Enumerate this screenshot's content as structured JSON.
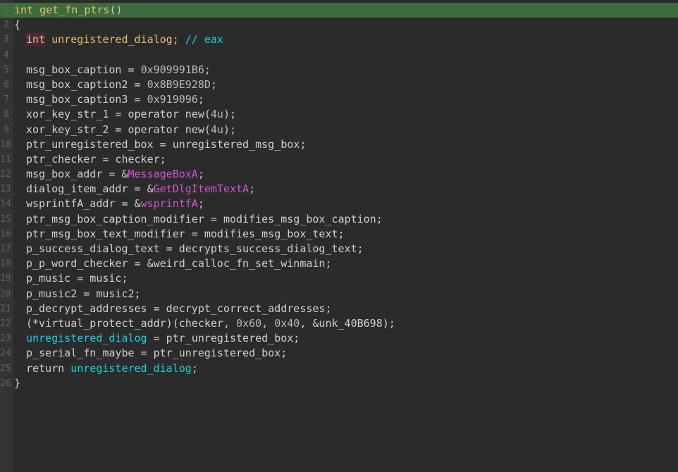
{
  "colors": {
    "background": "#2b2b2b",
    "highlight_line": "#3d6b3d",
    "keyword": "#e8bf6a",
    "import": "#d455d4",
    "global": "#1cd1e0",
    "plain": "#d0d0d0"
  },
  "code": {
    "lines": [
      {
        "num": "1",
        "indent": 0,
        "highlight": true,
        "tokens": [
          {
            "t": "int",
            "c": "keyword"
          },
          {
            "t": " ",
            "c": "plain"
          },
          {
            "t": "get_fn_ptrs",
            "c": "function"
          },
          {
            "t": "()",
            "c": "punct"
          }
        ]
      },
      {
        "num": "2",
        "indent": 0,
        "tokens": [
          {
            "t": "{",
            "c": "punct"
          }
        ]
      },
      {
        "num": "3",
        "indent": 1,
        "tokens": [
          {
            "t": "int",
            "c": "type"
          },
          {
            "t": " ",
            "c": "plain"
          },
          {
            "t": "unregistered_dialog",
            "c": "keyword"
          },
          {
            "t": "; ",
            "c": "punct"
          },
          {
            "t": "// eax",
            "c": "comment"
          }
        ]
      },
      {
        "num": "4",
        "indent": 0,
        "tokens": []
      },
      {
        "num": "5",
        "indent": 1,
        "tokens": [
          {
            "t": "msg_box_caption = ",
            "c": "plain"
          },
          {
            "t": "0x909991B6",
            "c": "number"
          },
          {
            "t": ";",
            "c": "punct"
          }
        ]
      },
      {
        "num": "6",
        "indent": 1,
        "tokens": [
          {
            "t": "msg_box_caption2 = ",
            "c": "plain"
          },
          {
            "t": "0x8B9E928D",
            "c": "number"
          },
          {
            "t": ";",
            "c": "punct"
          }
        ]
      },
      {
        "num": "7",
        "indent": 1,
        "tokens": [
          {
            "t": "msg_box_caption3 = ",
            "c": "plain"
          },
          {
            "t": "0x919096",
            "c": "number"
          },
          {
            "t": ";",
            "c": "punct"
          }
        ]
      },
      {
        "num": "8",
        "indent": 1,
        "tokens": [
          {
            "t": "xor_key_str_1 = operator new(",
            "c": "plain"
          },
          {
            "t": "4u",
            "c": "number"
          },
          {
            "t": ");",
            "c": "punct"
          }
        ]
      },
      {
        "num": "9",
        "indent": 1,
        "tokens": [
          {
            "t": "xor_key_str_2 = operator new(",
            "c": "plain"
          },
          {
            "t": "4u",
            "c": "number"
          },
          {
            "t": ");",
            "c": "punct"
          }
        ]
      },
      {
        "num": "10",
        "indent": 1,
        "tokens": [
          {
            "t": "ptr_unregistered_box = unregistered_msg_box;",
            "c": "plain"
          }
        ]
      },
      {
        "num": "11",
        "indent": 1,
        "tokens": [
          {
            "t": "ptr_checker = checker;",
            "c": "plain"
          }
        ]
      },
      {
        "num": "12",
        "indent": 1,
        "tokens": [
          {
            "t": "msg_box_addr = &",
            "c": "plain"
          },
          {
            "t": "MessageBoxA",
            "c": "import"
          },
          {
            "t": ";",
            "c": "punct"
          }
        ]
      },
      {
        "num": "13",
        "indent": 1,
        "tokens": [
          {
            "t": "dialog_item_addr = &",
            "c": "plain"
          },
          {
            "t": "GetDlgItemTextA",
            "c": "import"
          },
          {
            "t": ";",
            "c": "punct"
          }
        ]
      },
      {
        "num": "14",
        "indent": 1,
        "tokens": [
          {
            "t": "wsprintfA_addr = &",
            "c": "plain"
          },
          {
            "t": "wsprintfA",
            "c": "import"
          },
          {
            "t": ";",
            "c": "punct"
          }
        ]
      },
      {
        "num": "15",
        "indent": 1,
        "tokens": [
          {
            "t": "ptr_msg_box_caption_modifier = modifies_msg_box_caption;",
            "c": "plain"
          }
        ]
      },
      {
        "num": "16",
        "indent": 1,
        "tokens": [
          {
            "t": "ptr_msg_box_text_modifier = modifies_msg_box_text;",
            "c": "plain"
          }
        ]
      },
      {
        "num": "17",
        "indent": 1,
        "tokens": [
          {
            "t": "p_success_dialog_text = decrypts_success_dialog_text;",
            "c": "plain"
          }
        ]
      },
      {
        "num": "18",
        "indent": 1,
        "tokens": [
          {
            "t": "p_p_word_checker = &weird_calloc_fn_set_winmain;",
            "c": "plain"
          }
        ]
      },
      {
        "num": "19",
        "indent": 1,
        "tokens": [
          {
            "t": "p_music = music;",
            "c": "plain"
          }
        ]
      },
      {
        "num": "20",
        "indent": 1,
        "tokens": [
          {
            "t": "p_music2 = music2;",
            "c": "plain"
          }
        ]
      },
      {
        "num": "21",
        "indent": 1,
        "tokens": [
          {
            "t": "p_decrypt_addresses = decrypt_correct_addresses;",
            "c": "plain"
          }
        ]
      },
      {
        "num": "22",
        "indent": 1,
        "tokens": [
          {
            "t": "(*virtual_protect_addr)(checker, ",
            "c": "plain"
          },
          {
            "t": "0x60",
            "c": "number"
          },
          {
            "t": ", ",
            "c": "plain"
          },
          {
            "t": "0x40",
            "c": "number"
          },
          {
            "t": ", &unk_40B698);",
            "c": "plain"
          }
        ]
      },
      {
        "num": "23",
        "indent": 1,
        "tokens": [
          {
            "t": "unregistered_dialog",
            "c": "global"
          },
          {
            "t": " = ptr_unregistered_box;",
            "c": "plain"
          }
        ]
      },
      {
        "num": "24",
        "indent": 1,
        "tokens": [
          {
            "t": "p_serial_fn_maybe = ptr_unregistered_box;",
            "c": "plain"
          }
        ]
      },
      {
        "num": "25",
        "indent": 1,
        "tokens": [
          {
            "t": "return ",
            "c": "plain"
          },
          {
            "t": "unregistered_dialog",
            "c": "global"
          },
          {
            "t": ";",
            "c": "punct"
          }
        ]
      },
      {
        "num": "26",
        "indent": 0,
        "tokens": [
          {
            "t": "}",
            "c": "punct"
          }
        ]
      }
    ]
  }
}
